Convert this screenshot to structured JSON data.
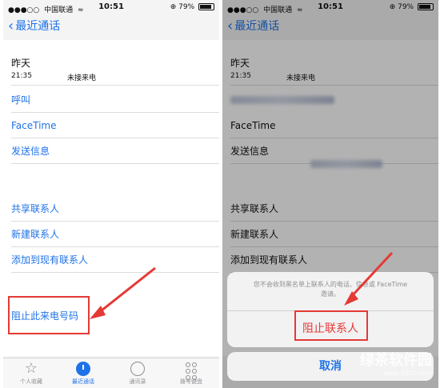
{
  "status": {
    "dots": "●●●○○",
    "carrier": "中国联通",
    "wifi": "≈",
    "time": "10:51",
    "battery_percent": "79%",
    "battery_level": 0.79
  },
  "nav": {
    "back_label": "最近通话"
  },
  "call": {
    "date": "昨天",
    "time": "21:35",
    "type": "未接来电"
  },
  "actions": {
    "call": "呼叫",
    "facetime": "FaceTime",
    "message": "发送信息",
    "share_contact": "共享联系人",
    "new_contact": "新建联系人",
    "add_existing": "添加到现有联系人",
    "block_number": "阻止此来电号码"
  },
  "tabs": [
    {
      "label": "个人收藏"
    },
    {
      "label": "最近通话"
    },
    {
      "label": "通讯录"
    },
    {
      "label": "拨号键盘"
    }
  ],
  "dialog": {
    "message_line1": "您不会收到黑名单上联系人的电话、信息或 FaceTime",
    "message_line2": "邀请。",
    "block_contact": "阻止联系人",
    "cancel": "取消"
  },
  "watermark": {
    "title": "绿茶软件园",
    "url": "www.33LC.com"
  },
  "colors": {
    "accent": "#1f73e8",
    "highlight": "#e53935"
  }
}
